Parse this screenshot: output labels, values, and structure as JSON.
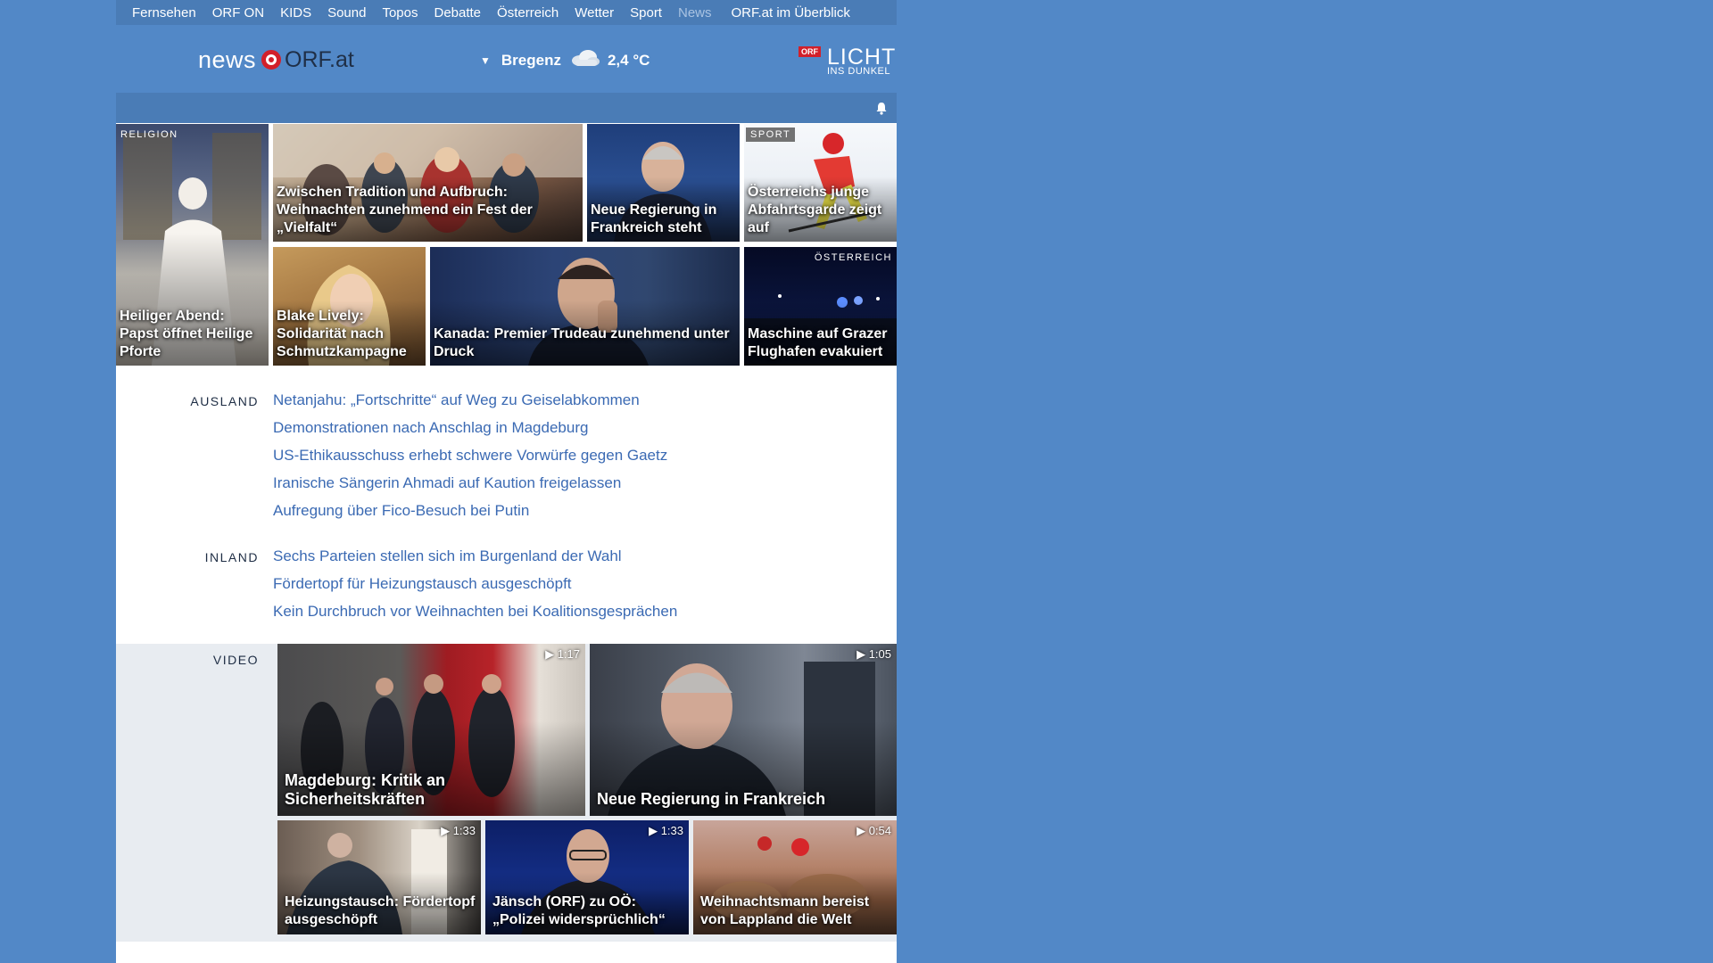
{
  "topnav": [
    "Fernsehen",
    "ORF ON",
    "KIDS",
    "Sound",
    "Topos",
    "Debatte",
    "Österreich",
    "Wetter",
    "Sport",
    "News",
    "ORF.at im Überblick"
  ],
  "logo": {
    "news": "news",
    "orf": "ORF.at"
  },
  "weather": {
    "location": "Bregenz",
    "temperature": "2,4 °C"
  },
  "licht": {
    "orf": "ORF",
    "licht": "LICHT",
    "ins": "INS DUNKEL"
  },
  "tiles": [
    {
      "tag": "RELIGION",
      "caption": "Heiliger Abend: Papst öffnet Heilige Pforte"
    },
    {
      "tag": "",
      "caption": "Zwischen Tradition und Aufbruch: Weihnachten zunehmend ein Fest der „Vielfalt“"
    },
    {
      "tag": "",
      "caption": "Neue Regierung in Frankreich steht"
    },
    {
      "tag": "SPORT",
      "caption": "Österreichs junge Abfahrtsgarde zeigt auf"
    },
    {
      "tag": "",
      "caption": "Blake Lively: Solidarität nach Schmutzkampagne"
    },
    {
      "tag": "",
      "caption": "Kanada: Premier Trudeau zunehmend unter Druck"
    },
    {
      "tag": "ÖSTERREICH",
      "caption": "Maschine auf Grazer Flughafen evakuiert"
    }
  ],
  "sections": {
    "ausland": {
      "label": "AUSLAND",
      "stories": [
        "Netanjahu: „Fortschritte“ auf Weg zu Geiselabkommen",
        "Demonstrationen nach Anschlag in Magdeburg",
        "US-Ethikausschuss erhebt schwere Vorwürfe gegen Gaetz",
        "Iranische Sängerin Ahmadi auf Kaution freigelassen",
        "Aufregung über Fico-Besuch bei Putin"
      ]
    },
    "inland": {
      "label": "INLAND",
      "stories": [
        "Sechs Parteien stellen sich im Burgenland der Wahl",
        "Fördertopf für Heizungstausch ausgeschöpft",
        "Kein Durchbruch vor Weihnachten bei Koalitionsgesprächen"
      ]
    },
    "video": {
      "label": "VIDEO",
      "items": [
        {
          "duration": "1:17",
          "caption": "Magdeburg: Kritik an Sicherheitskräften"
        },
        {
          "duration": "1:05",
          "caption": "Neue Regierung in Frankreich"
        },
        {
          "duration": "1:33",
          "caption": "Heizungstausch: Fördertopf ausgeschöpft"
        },
        {
          "duration": "1:33",
          "caption": "Jänsch (ORF) zu OÖ: „Polizei widersprüchlich“"
        },
        {
          "duration": "0:54",
          "caption": "Weihnachtsmann bereist von Lappland die Welt"
        }
      ]
    }
  },
  "colors": {
    "background": "#5288c7",
    "navbar": "#4a7cb6",
    "link": "#3b6ab3",
    "brand_red": "#d2202a"
  }
}
